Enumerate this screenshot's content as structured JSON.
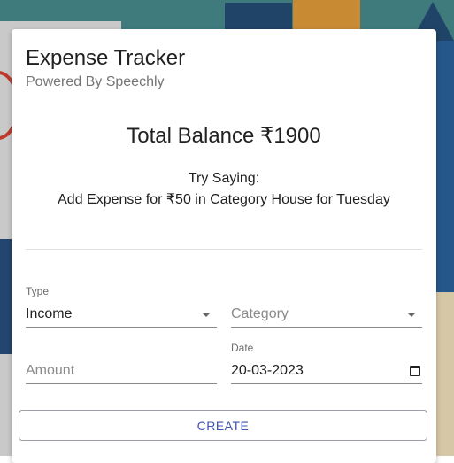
{
  "card": {
    "title": "Expense Tracker",
    "subtitle": "Powered By Speechly"
  },
  "balance": {
    "text": "Total Balance ₹1900"
  },
  "hint": {
    "line1": "Try Saying:",
    "line2": "Add Expense for ₹50 in Category House for Tuesday"
  },
  "form": {
    "type": {
      "label": "Type",
      "value": "Income",
      "icon": "chevron-down-icon"
    },
    "category": {
      "placeholder": "Category",
      "value": "",
      "icon": "chevron-down-icon"
    },
    "amount": {
      "placeholder": "Amount",
      "value": ""
    },
    "date": {
      "label": "Date",
      "value": "20-03-2023",
      "icon": "calendar-icon"
    }
  },
  "actions": {
    "create_label": "CREATE"
  },
  "colors": {
    "accent": "#3f51b5",
    "background": "#3f7a7d",
    "card": "#ffffff"
  }
}
